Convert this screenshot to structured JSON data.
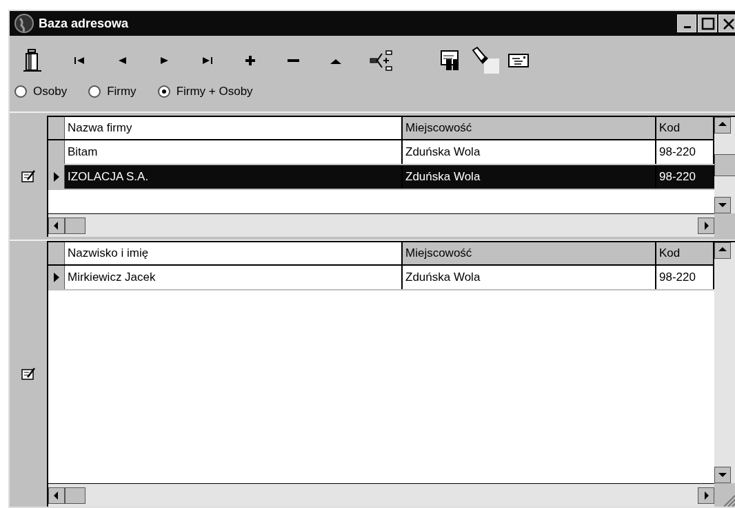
{
  "window": {
    "title": "Baza adresowa"
  },
  "toolbar": [
    {
      "kind": "exit"
    },
    {
      "kind": "first"
    },
    {
      "kind": "prev"
    },
    {
      "kind": "next"
    },
    {
      "kind": "last"
    },
    {
      "kind": "add"
    },
    {
      "kind": "delete"
    },
    {
      "kind": "up"
    },
    {
      "kind": "tree"
    },
    {
      "kind": "find"
    },
    {
      "kind": "filter"
    },
    {
      "kind": "card"
    }
  ],
  "view_options": [
    {
      "label": "Osoby",
      "selected": false
    },
    {
      "label": "Firmy",
      "selected": false
    },
    {
      "label": "Firmy + Osoby",
      "selected": true
    }
  ],
  "grids": [
    {
      "columns": [
        "Nazwa firmy",
        "Miejscowość",
        "Kod"
      ],
      "rows": [
        {
          "cells": [
            "Bitam",
            "Zduńska Wola",
            "98-220"
          ],
          "current": false,
          "selected": false
        },
        {
          "cells": [
            "IZOLACJA S.A.",
            "Zduńska Wola",
            "98-220"
          ],
          "current": true,
          "selected": true
        }
      ]
    },
    {
      "columns": [
        "Nazwisko i imię",
        "Miejscowość",
        "Kod"
      ],
      "rows": [
        {
          "cells": [
            "Mirkiewicz Jacek",
            "Zduńska Wola",
            "98-220"
          ],
          "current": true,
          "selected": false
        }
      ]
    }
  ]
}
